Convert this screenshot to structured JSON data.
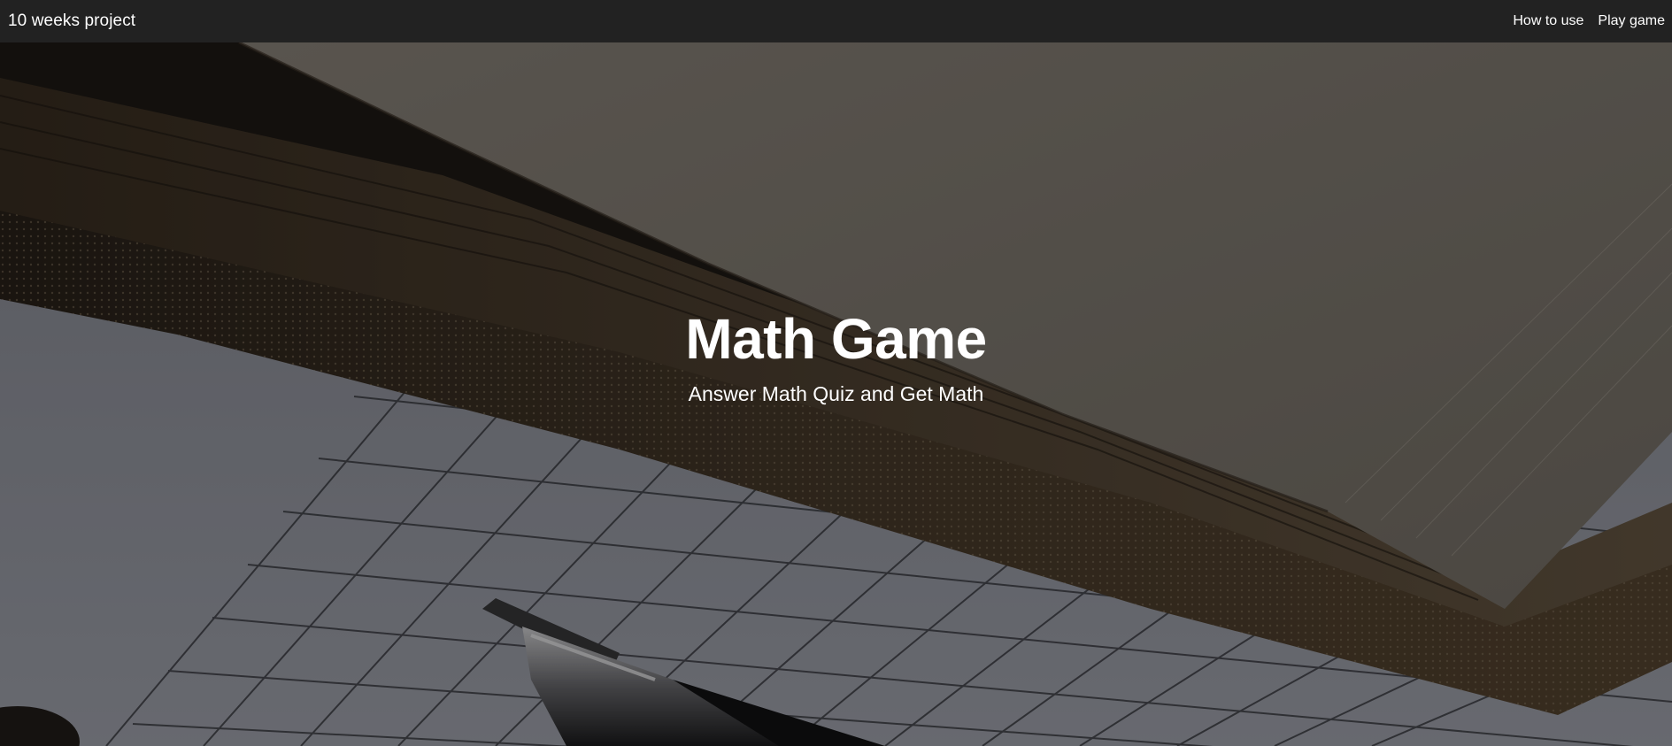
{
  "navbar": {
    "brand": "10 weeks project",
    "links": [
      {
        "label": "How to use"
      },
      {
        "label": "Play game"
      }
    ]
  },
  "hero": {
    "title": "Math Game",
    "subtitle": "Answer Math Quiz and Get Math",
    "background_image": "photo of an open notebook over graph paper with a pen"
  },
  "colors": {
    "navbar_bg": "#222222",
    "text": "#ffffff"
  }
}
